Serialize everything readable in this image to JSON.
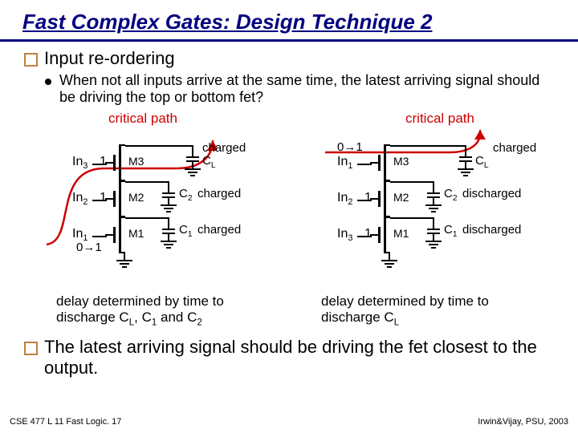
{
  "title": "Fast Complex Gates:  Design Technique 2",
  "bullet1": "Input re-ordering",
  "bullet2": "When not all inputs arrive at the same time, the latest arriving signal should be driving the top or bottom fet?",
  "left": {
    "cp": "critical path",
    "in3": "In",
    "in3sub": "3",
    "in3val": "1",
    "in2": "In",
    "in2sub": "2",
    "in2val": "1",
    "in1": "In",
    "in1sub": "1",
    "in1val": "0→1",
    "m3": "M3",
    "m2": "M2",
    "m1": "M1",
    "cl": "C",
    "clsub": "L",
    "cl_state": "charged",
    "c2": "C",
    "c2sub": "2",
    "c2_state": "charged",
    "c1": "C",
    "c1sub": "1",
    "c1_state": "charged",
    "caption_a": "delay determined by time to",
    "caption_b": "discharge C",
    "caption_c": ", C",
    "caption_d": " and C",
    "caption_subL": "L",
    "caption_sub1": "1",
    "caption_sub2": "2"
  },
  "right": {
    "cp": "critical path",
    "in1": "In",
    "in1sub": "1",
    "in1val": "0→1",
    "in2": "In",
    "in2sub": "2",
    "in2val": "1",
    "in3": "In",
    "in3sub": "3",
    "in3val": "1",
    "m3": "M3",
    "m2": "M2",
    "m1": "M1",
    "cl": "C",
    "clsub": "L",
    "cl_state": "charged",
    "c2": "C",
    "c2sub": "2",
    "c2_state": "discharged",
    "c1": "C",
    "c1sub": "1",
    "c1_state": "discharged",
    "caption_a": "delay determined by time to",
    "caption_b": "discharge C",
    "caption_subL": "L"
  },
  "conclusion": "The latest arriving signal should be driving the fet closest to the output.",
  "footer_left": "CSE 477  L 11 Fast Logic. 17",
  "footer_right": "Irwin&Vijay, PSU, 2003"
}
